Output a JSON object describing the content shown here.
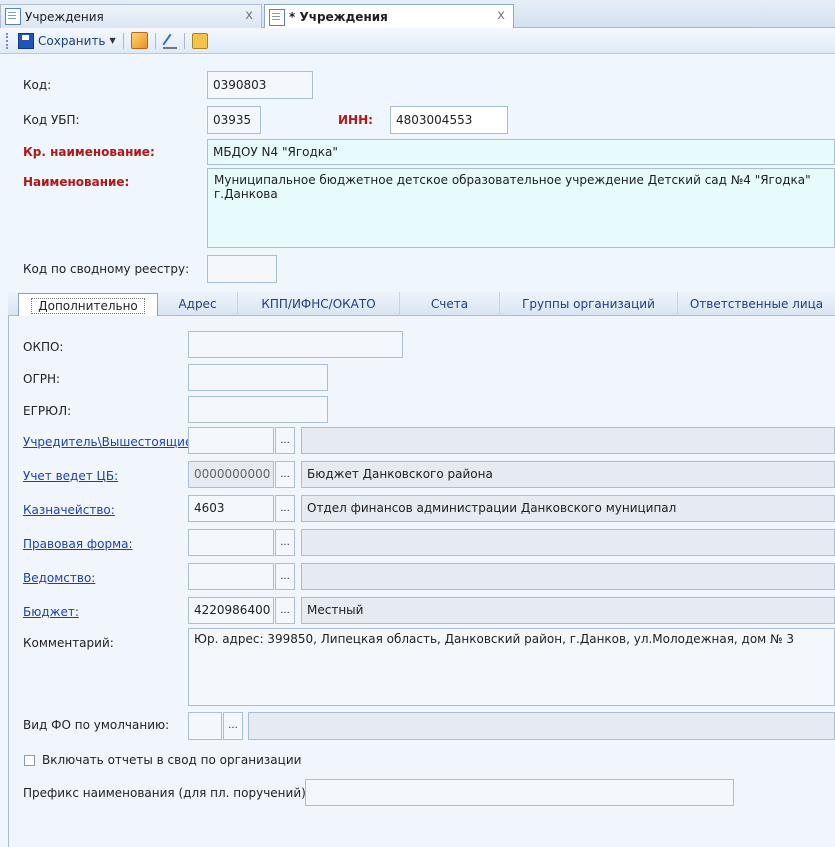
{
  "tabs": [
    {
      "title": "Учреждения",
      "close": "x"
    },
    {
      "title": "* Учреждения",
      "close": "x"
    }
  ],
  "toolbar": {
    "save_label": "Сохранить"
  },
  "form": {
    "kod_label": "Код:",
    "kod_value": "0390803",
    "kod_ubp_label": "Код УБП:",
    "kod_ubp_value": "03935",
    "inn_label": "ИНН:",
    "inn_value": "4803004553",
    "short_name_label": "Кр. наименование:",
    "short_name_value": "МБДОУ N4 \"Ягодка\"",
    "name_label": "Наименование:",
    "name_value": "Муниципальное бюджетное детское образовательное учреждение Детский сад №4 \"Ягодка\" г.Данкова",
    "registry_label": "Код по сводному реестру:",
    "registry_value": ""
  },
  "inner_tabs": [
    "Дополнительно",
    "Адрес",
    "КПП/ИФНС/ОКАТО",
    "Счета",
    "Группы организаций",
    "Ответственные лица"
  ],
  "details": {
    "okpo_label": "ОКПО:",
    "ogrn_label": "ОГРН:",
    "egrul_label": "ЕГРЮЛ:",
    "founder_label": "Учредитель\\Вышестоящие:",
    "cb_label": "Учет ведет ЦБ:",
    "cb_code": "0000000000",
    "cb_name": "Бюджет Данковского района",
    "treasury_label": "Казначейство:",
    "treasury_code": "4603",
    "treasury_name": "Отдел финансов администрации Данковского муниципал",
    "legal_form_label": "Правовая форма:",
    "dept_label": "Ведомство:",
    "budget_label": "Бюджет:",
    "budget_code": "4220986400",
    "budget_name": "Местный",
    "comment_label": "Комментарий:",
    "comment_value": "Юр. адрес: 399850, Липецкая область, Данковский район, г.Данков, ул.Молодежная, дом № 3",
    "fo_label": "Вид ФО по умолчанию:",
    "include_label": "Включать отчеты в свод по организации",
    "prefix_label": "Префикс наименования (для пл. поручений):",
    "dots": "..."
  }
}
